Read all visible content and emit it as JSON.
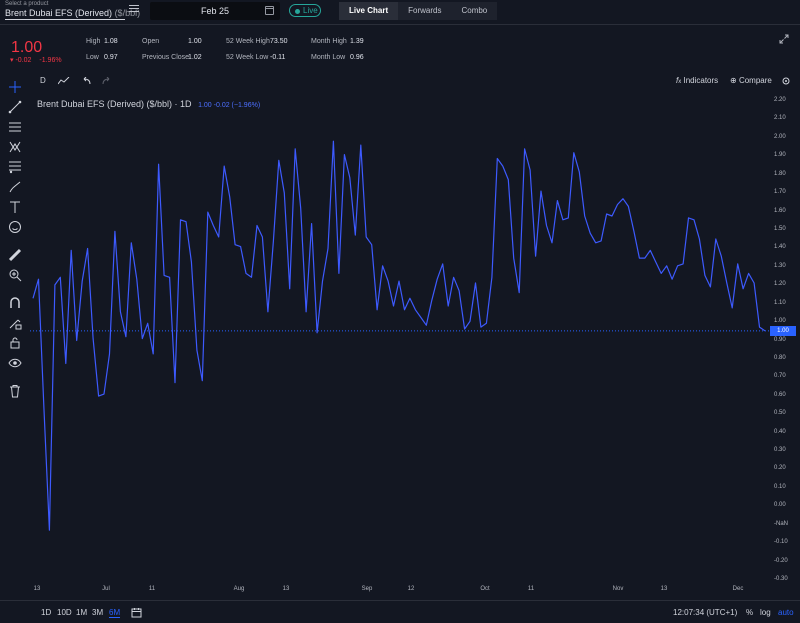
{
  "product": {
    "caption": "Select a product",
    "name": "Brent Dubai EFS (Derived)",
    "unit": "($/bbl)"
  },
  "date": {
    "value": "Feb 25"
  },
  "live": {
    "label": "Live"
  },
  "mode_tabs": [
    {
      "label": "Live Chart",
      "active": true
    },
    {
      "label": "Forwards",
      "active": false
    },
    {
      "label": "Combo",
      "active": false
    }
  ],
  "quote": {
    "price": "1.00",
    "change": "-0.02",
    "change_pct": "-1.96%"
  },
  "stats": {
    "high_label": "High",
    "high": "1.08",
    "low_label": "Low",
    "low": "0.97",
    "open_label": "Open",
    "open": "1.00",
    "prev_close_label": "Previous Close",
    "prev_close": "1.02",
    "wk52_high_label": "52 Week High",
    "wk52_high": "73.50",
    "wk52_low_label": "52 Week Low",
    "wk52_low": "-0.11",
    "month_high_label": "Month High",
    "month_high": "1.39",
    "month_low_label": "Month Low",
    "month_low": "0.96"
  },
  "chart_toolbar": {
    "interval": "D",
    "indicators": "Indicators",
    "compare": "Compare"
  },
  "legend": {
    "title": "Brent Dubai EFS (Derived) ($/bbl) · 1D",
    "values": "1.00  -0.02 (−1.96%)"
  },
  "colors": {
    "background": "#131722",
    "line": "#3d5afe",
    "down": "#f23645",
    "accent": "#2962ff",
    "live": "#26a69a"
  },
  "chart_data": {
    "type": "line",
    "ylim": [
      -0.3,
      2.2
    ],
    "y_ticks": [
      "2.20",
      "2.10",
      "2.00",
      "1.90",
      "1.80",
      "1.70",
      "1.60",
      "1.50",
      "1.40",
      "1.30",
      "1.20",
      "1.10",
      "1.00",
      "0.90",
      "0.80",
      "0.70",
      "0.60",
      "0.50",
      "0.40",
      "0.30",
      "0.20",
      "0.10",
      "0.00",
      "-NaN",
      "-0.10",
      "-0.20",
      "-0.30"
    ],
    "x_ticks": [
      "13",
      "Jul",
      "11",
      "Aug",
      "13",
      "Sep",
      "12",
      "Oct",
      "11",
      "Nov",
      "13",
      "Dec"
    ],
    "last_price_label": "1.00",
    "series": [
      {
        "values": [
          1.17,
          1.27,
          0.6,
          -0.04,
          1.24,
          1.28,
          0.83,
          1.42,
          0.95,
          1.26,
          1.43,
          0.96,
          0.66,
          0.67,
          0.88,
          1.52,
          1.1,
          0.97,
          1.46,
          1.27,
          0.96,
          1.04,
          0.88,
          1.87,
          1.29,
          1.28,
          0.73,
          1.58,
          1.57,
          1.36,
          0.9,
          0.74,
          1.62,
          1.55,
          1.49,
          1.86,
          1.7,
          1.45,
          1.44,
          1.3,
          1.28,
          1.55,
          1.49,
          1.1,
          1.47,
          1.89,
          1.72,
          1.22,
          1.95,
          1.64,
          1.1,
          1.56,
          0.99,
          1.26,
          1.43,
          1.99,
          1.3,
          1.92,
          1.8,
          1.5,
          1.97,
          1.49,
          1.45,
          1.11,
          1.34,
          1.26,
          1.13,
          1.26,
          1.11,
          1.17,
          1.11,
          1.07,
          1.03,
          1.16,
          1.27,
          1.35,
          1.13,
          1.28,
          1.21,
          1.01,
          1.05,
          1.25,
          1.02,
          1.04,
          1.28,
          1.9,
          1.86,
          1.79,
          1.38,
          1.2,
          1.95,
          1.84,
          1.39,
          1.73,
          1.55,
          1.46,
          1.68,
          1.58,
          1.59,
          1.93,
          1.83,
          1.6,
          1.51,
          1.46,
          1.47,
          1.61,
          1.6,
          1.66,
          1.69,
          1.65,
          1.52,
          1.38,
          1.38,
          1.42,
          1.36,
          1.3,
          1.34,
          1.27,
          1.34,
          1.35,
          1.59,
          1.58,
          1.48,
          1.29,
          1.23,
          1.48,
          1.39,
          1.25,
          1.12,
          1.35,
          1.22,
          1.3,
          1.25,
          1.02,
          1.0
        ]
      }
    ]
  },
  "ranges": [
    {
      "label": "1D",
      "active": false
    },
    {
      "label": "10D",
      "active": false
    },
    {
      "label": "1M",
      "active": false
    },
    {
      "label": "3M",
      "active": false
    },
    {
      "label": "6M",
      "active": true
    }
  ],
  "bottom": {
    "clock": "12:07:34 (UTC+1)",
    "percent": "%",
    "log": "log",
    "auto": "auto"
  }
}
